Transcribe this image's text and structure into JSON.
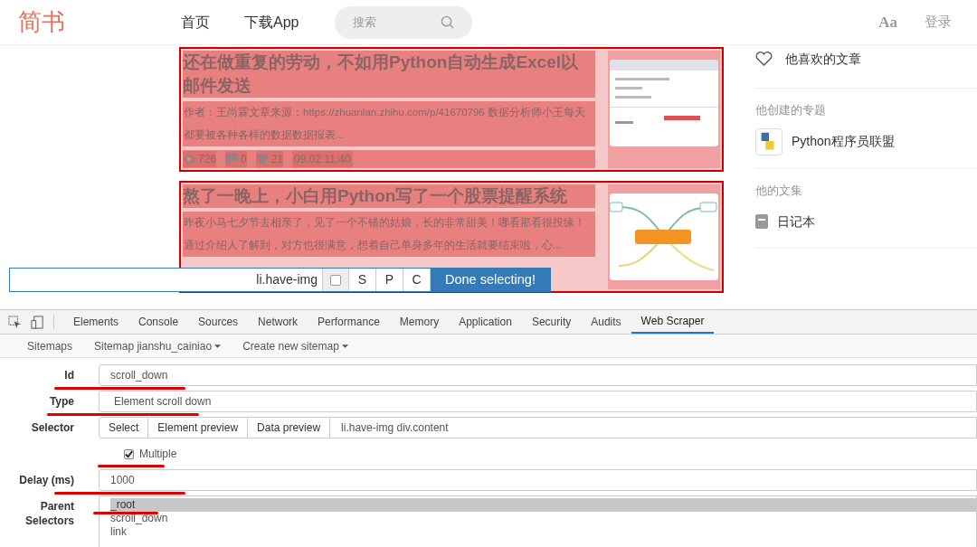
{
  "header": {
    "logo": "简书",
    "nav": [
      {
        "label": "首页"
      },
      {
        "label": "下载App"
      }
    ],
    "search": {
      "placeholder": "搜索"
    },
    "font_toggle": "Aa",
    "login": "登录"
  },
  "articles": [
    {
      "title": "还在做重复的劳动，不如用Python自动生成Excel以邮件发送",
      "excerpt": "作者：王尚霖文章来源：https://zhuanlan.zhihu.com/p/41670796 数据分析师小王每天都要被各种各样的数据数据报表...",
      "stats": [
        {
          "kind": "views",
          "value": "726"
        },
        {
          "kind": "comments",
          "value": "0"
        },
        {
          "kind": "likes",
          "value": "21"
        }
      ],
      "time": "09.02 11:40"
    },
    {
      "title": "熬了一晚上，小白用Python写了一个股票提醒系统",
      "excerpt": "昨夜小马七夕节去相亲了，见了一个不错的姑娘，长的非常甜美！哪看那看很投缘！通过介绍人了解到，对方也很满意，想着自己单身多年的生活就要结束啦，心..."
    }
  ],
  "sidebar": {
    "liked": "他喜欢的文章",
    "sections": [
      {
        "heading": "他创建的专题",
        "items": [
          {
            "kind": "topic",
            "label": "Python程序员联盟"
          }
        ]
      },
      {
        "heading": "他的文集",
        "items": [
          {
            "kind": "notebook",
            "label": "日记本"
          }
        ]
      }
    ]
  },
  "selector_bar": {
    "value": "li.have-img",
    "checked": false,
    "buttons": [
      "S",
      "P",
      "C"
    ],
    "done": "Done selecting!"
  },
  "devtools": {
    "tabs": [
      {
        "label": "Elements",
        "selected": false
      },
      {
        "label": "Console",
        "selected": false
      },
      {
        "label": "Sources",
        "selected": false
      },
      {
        "label": "Network",
        "selected": false
      },
      {
        "label": "Performance",
        "selected": false
      },
      {
        "label": "Memory",
        "selected": false
      },
      {
        "label": "Application",
        "selected": false
      },
      {
        "label": "Security",
        "selected": false
      },
      {
        "label": "Audits",
        "selected": false
      },
      {
        "label": "Web Scraper",
        "selected": true
      }
    ],
    "subnav": [
      {
        "label": "Sitemaps",
        "dropdown": false
      },
      {
        "label": "Sitemap jianshu_cainiao",
        "dropdown": true
      },
      {
        "label": "Create new sitemap",
        "dropdown": true
      }
    ],
    "form": [
      {
        "kind": "text",
        "label": "Id",
        "value": "scroll_down",
        "underlined": true
      },
      {
        "kind": "select",
        "label": "Type",
        "value": "Element scroll down",
        "underlined": true
      },
      {
        "kind": "selector",
        "label": "Selector",
        "buttons": [
          "Select",
          "Element preview",
          "Data preview"
        ],
        "value": "li.have-img div.content",
        "underlined": false
      },
      {
        "kind": "checkbox",
        "label": "Multiple",
        "checked": true,
        "underlined": true
      },
      {
        "kind": "text",
        "label": "Delay (ms)",
        "value": "1000",
        "underlined": true
      },
      {
        "kind": "list",
        "label": "Parent Selectors",
        "options": [
          {
            "label": "_root",
            "selected": true
          },
          {
            "label": "scroll_down",
            "selected": false
          },
          {
            "label": "link",
            "selected": false
          }
        ],
        "underlined": true
      }
    ]
  }
}
